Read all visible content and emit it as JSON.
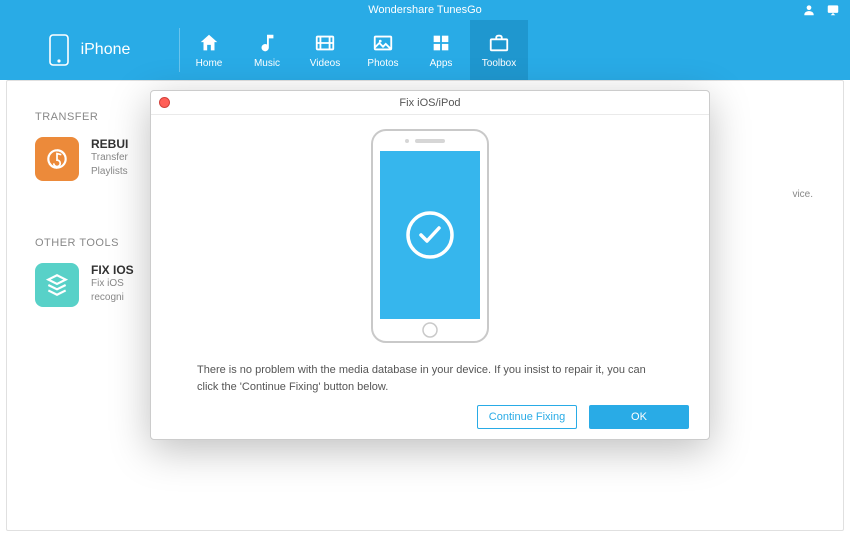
{
  "app": {
    "title": "Wondershare TunesGo"
  },
  "device": {
    "name": "iPhone"
  },
  "nav": {
    "items": [
      {
        "label": "Home"
      },
      {
        "label": "Music"
      },
      {
        "label": "Videos"
      },
      {
        "label": "Photos"
      },
      {
        "label": "Apps"
      },
      {
        "label": "Toolbox"
      }
    ]
  },
  "sections": {
    "transfer": {
      "heading": "TRANSFER",
      "card": {
        "title": "REBUI",
        "desc1": "Transfer",
        "desc2": "Playlists"
      }
    },
    "other": {
      "heading": "OTHER TOOLS",
      "card": {
        "title": "FIX IOS",
        "desc1": "Fix iOS",
        "desc2": "recogni"
      }
    },
    "side_note": "vice."
  },
  "modal": {
    "title": "Fix iOS/iPod",
    "message": "There is no problem with the media database in your device. If you insist to repair it, you can click the 'Continue Fixing' button below.",
    "continue_label": "Continue Fixing",
    "ok_label": "OK"
  }
}
